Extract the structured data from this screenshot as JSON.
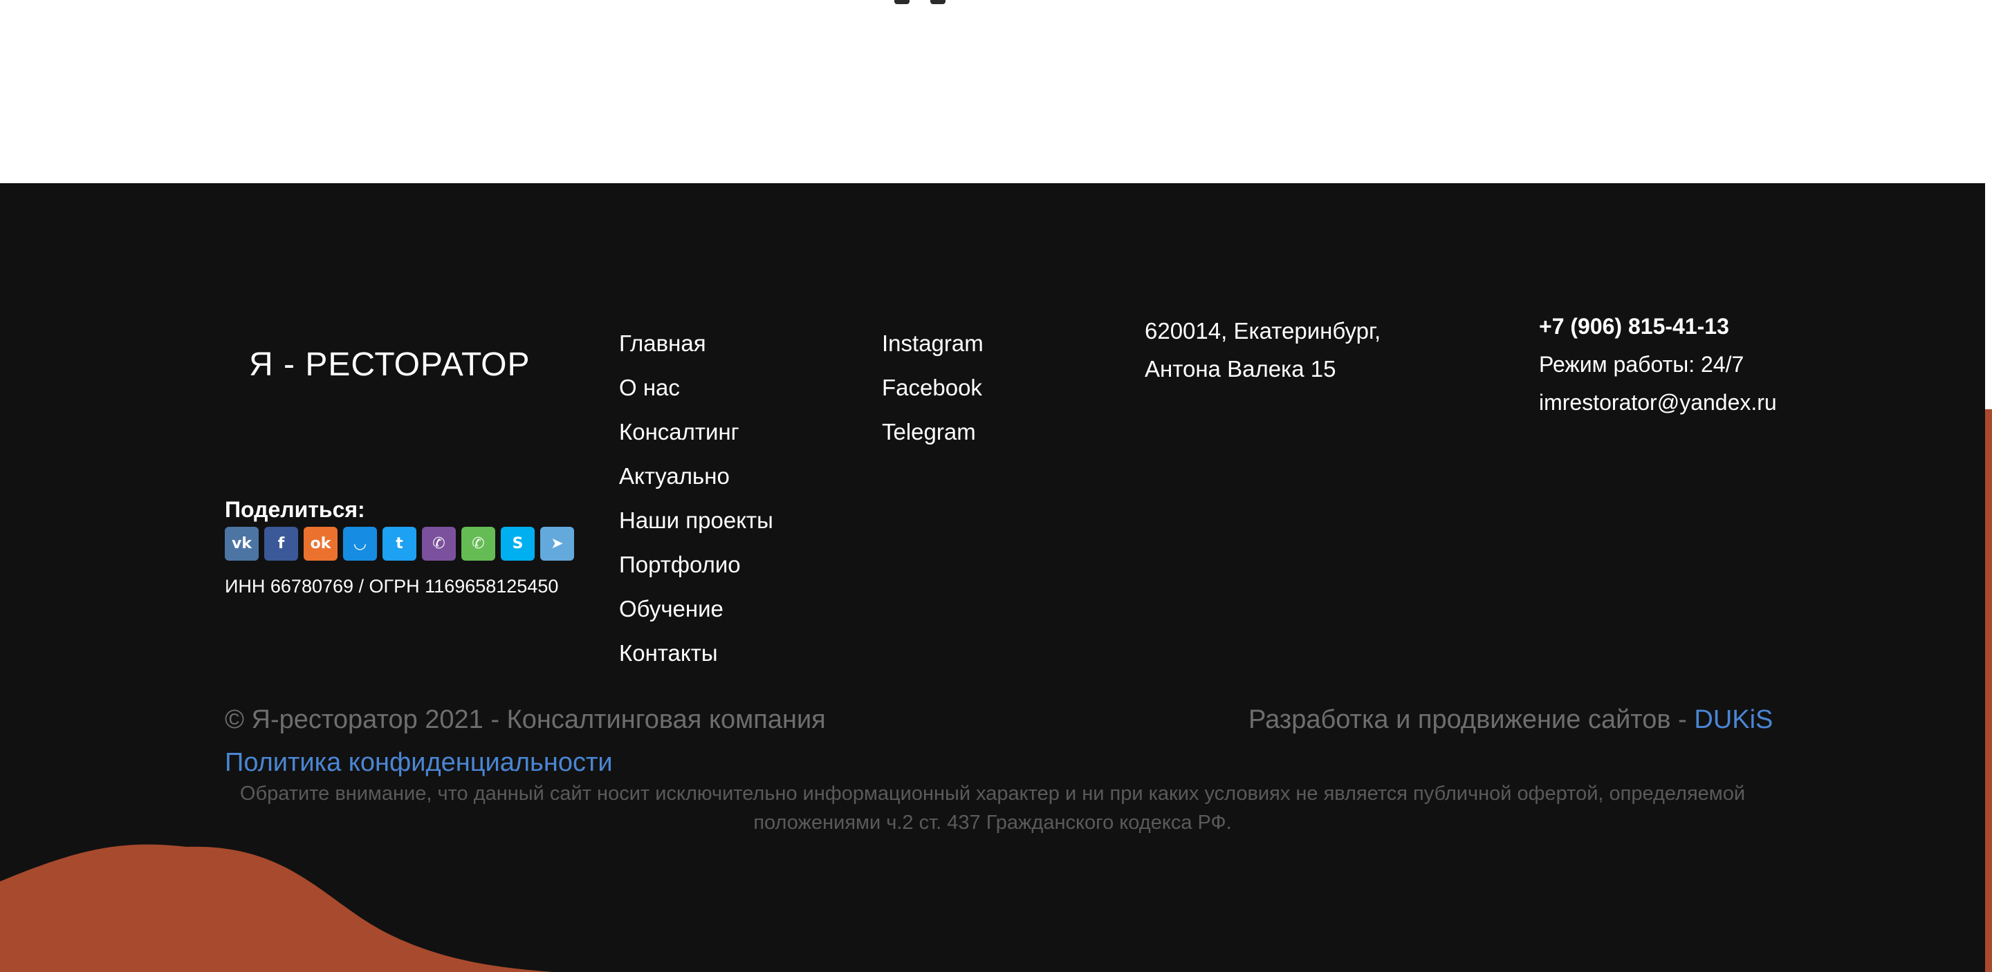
{
  "brand": {
    "logo": "Я - РЕСТОРАТОР"
  },
  "share": {
    "label": "Поделиться:",
    "icons": [
      {
        "name": "vk-icon",
        "glyph": "vk",
        "color": "#4c75a3"
      },
      {
        "name": "facebook-icon",
        "glyph": "f",
        "color": "#3b5998"
      },
      {
        "name": "odnoklassniki-icon",
        "glyph": "ok",
        "color": "#eb722e"
      },
      {
        "name": "moimir-icon",
        "glyph": "◡",
        "color": "#168de2"
      },
      {
        "name": "twitter-icon",
        "glyph": "t",
        "color": "#1da1f2"
      },
      {
        "name": "viber-icon",
        "glyph": "✆",
        "color": "#7b519d"
      },
      {
        "name": "whatsapp-icon",
        "glyph": "✆",
        "color": "#65bc54"
      },
      {
        "name": "skype-icon",
        "glyph": "S",
        "color": "#00aff0"
      },
      {
        "name": "telegram-icon",
        "glyph": "➤",
        "color": "#64a9dc"
      }
    ]
  },
  "legal": {
    "inn": "ИНН 66780769 / ОГРН 1169658125450"
  },
  "nav": {
    "items": [
      "Главная",
      "О нас",
      "Консалтинг",
      "Актуально",
      "Наши проекты",
      "Портфолио",
      "Обучение",
      "Контакты"
    ]
  },
  "social_links": {
    "items": [
      "Instagram",
      "Facebook",
      "Telegram"
    ]
  },
  "address": {
    "line1": "620014, Екатеринбург,",
    "line2": "Антона Валека 15"
  },
  "contact": {
    "phone": "+7 (906) 815-41-13",
    "hours": "Режим работы: 24/7",
    "email": "imrestorator@yandex.ru"
  },
  "bottom": {
    "copyright": "© Я-ресторатор 2021 - Консалтинговая компания",
    "dev_text": "Разработка и продвижение сайтов - ",
    "dev_link": "DUKiS",
    "policy": "Политика конфиденциальности",
    "notice": "Обратите внимание, что данный сайт носит исключительно информационный характер и ни при каких условиях не является публичной офертой, определяемой положениями ч.2 ст. 437 Гражданского кодекса РФ."
  },
  "colors": {
    "footer_bg": "#111111",
    "accent": "#a84a2d",
    "link": "#4a86d4"
  }
}
